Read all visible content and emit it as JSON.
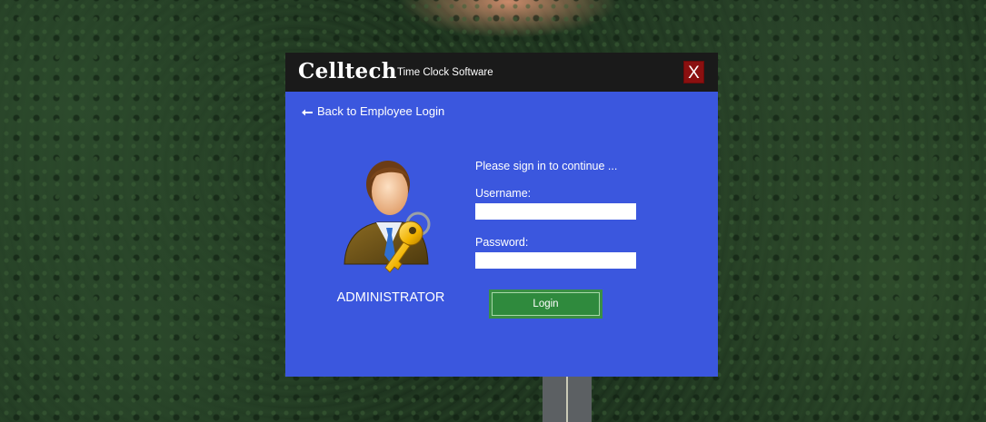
{
  "window": {
    "brand": "Celltech",
    "subtitle": "Time Clock Software",
    "close_label": "X"
  },
  "nav": {
    "back_label": "Back to Employee Login",
    "back_icon": "arrow-left-icon"
  },
  "profile": {
    "role_label": "ADMINISTRATOR",
    "avatar_icon": "administrator-key-icon"
  },
  "form": {
    "prompt": "Please sign in to continue ...",
    "username_label": "Username:",
    "username_value": "",
    "password_label": "Password:",
    "password_value": "",
    "login_label": "Login"
  },
  "colors": {
    "dialog_bg": "#3b57de",
    "titlebar_bg": "#1a1a1a",
    "close_bg": "#8b1010",
    "login_bg": "#3a8f44"
  }
}
